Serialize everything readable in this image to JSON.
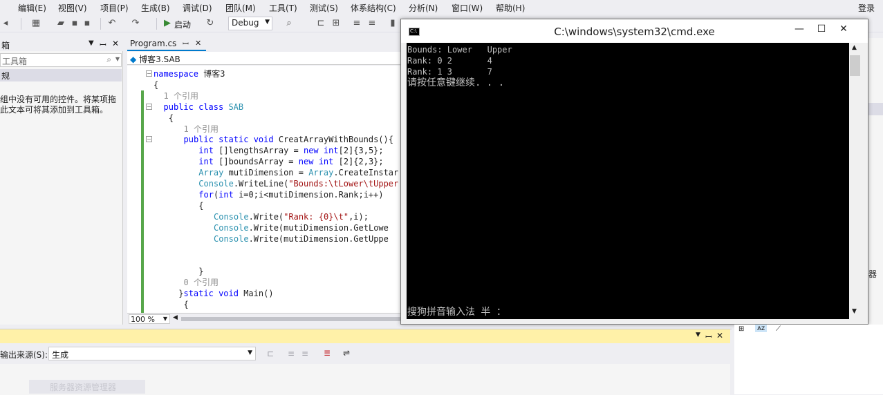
{
  "menubar": {
    "items": [
      "编辑(E)",
      "视图(V)",
      "项目(P)",
      "生成(B)",
      "调试(D)",
      "团队(M)",
      "工具(T)",
      "测试(S)",
      "体系结构(C)",
      "分析(N)",
      "窗口(W)",
      "帮助(H)"
    ],
    "login": "登录"
  },
  "toolbar": {
    "start_label": "启动",
    "config": "Debug"
  },
  "toolbox": {
    "title": "箱",
    "search_placeholder": "工具箱",
    "group": "规",
    "message_line1": "组中没有可用的控件。将某项拖",
    "message_line2": "此文本可将其添加到工具箱。"
  },
  "editor": {
    "tab_label": "Program.cs",
    "nav_label": "博客3.SAB",
    "zoom": "100 %",
    "lines": [
      {
        "indent": 0,
        "text": "namespace 博客3",
        "kind": "code"
      },
      {
        "indent": 0,
        "text": "{",
        "kind": "code"
      },
      {
        "indent": 2,
        "text": "1 个引用",
        "kind": "ref"
      },
      {
        "indent": 2,
        "text": "public class SAB",
        "kind": "code"
      },
      {
        "indent": 3,
        "text": "{",
        "kind": "code"
      },
      {
        "indent": 6,
        "text": "1 个引用",
        "kind": "ref"
      },
      {
        "indent": 6,
        "text": "public static void CreatArrayWithBounds(){",
        "kind": "code"
      },
      {
        "indent": 9,
        "text": "int []lengthsArray = new int[2]{3,5};",
        "kind": "code"
      },
      {
        "indent": 9,
        "text": "int []boundsArray = new int [2]{2,3};",
        "kind": "code"
      },
      {
        "indent": 9,
        "text": "Array mutiDimension = Array.CreateInstar",
        "kind": "code"
      },
      {
        "indent": 9,
        "text": "Console.WriteLine(\"Bounds:\\tLower\\tUpper",
        "kind": "code"
      },
      {
        "indent": 9,
        "text": "for(int i=0;i<mutiDimension.Rank;i++)",
        "kind": "code"
      },
      {
        "indent": 9,
        "text": "{",
        "kind": "code"
      },
      {
        "indent": 12,
        "text": "Console.Write(\"Rank: {0}\\t\",i);",
        "kind": "code"
      },
      {
        "indent": 12,
        "text": "Console.Write(mutiDimension.GetLowe",
        "kind": "code"
      },
      {
        "indent": 12,
        "text": "Console.Write(mutiDimension.GetUppe",
        "kind": "code"
      },
      {
        "indent": 0,
        "text": "",
        "kind": "code"
      },
      {
        "indent": 0,
        "text": "",
        "kind": "code"
      },
      {
        "indent": 9,
        "text": "}",
        "kind": "code"
      },
      {
        "indent": 6,
        "text": "0 个引用",
        "kind": "ref"
      },
      {
        "indent": 5,
        "text": "}static void Main()",
        "kind": "code"
      },
      {
        "indent": 6,
        "text": "{",
        "kind": "code"
      }
    ]
  },
  "cmd": {
    "title": "C:\\windows\\system32\\cmd.exe",
    "output": [
      "Bounds: Lower   Upper",
      "Rank: 0 2       4",
      "Rank: 1 3       7",
      "请按任意键继续. . ."
    ],
    "ime_status": "搜狗拼音输入法 半 ："
  },
  "output_panel": {
    "source_label": "输出来源(S):",
    "source_value": "生成",
    "faded_item": "服务器资源管理器"
  },
  "colors": {
    "accent": "#007acc",
    "output_title_bg": "#fff1a8",
    "change_bar": "#57a64a"
  }
}
